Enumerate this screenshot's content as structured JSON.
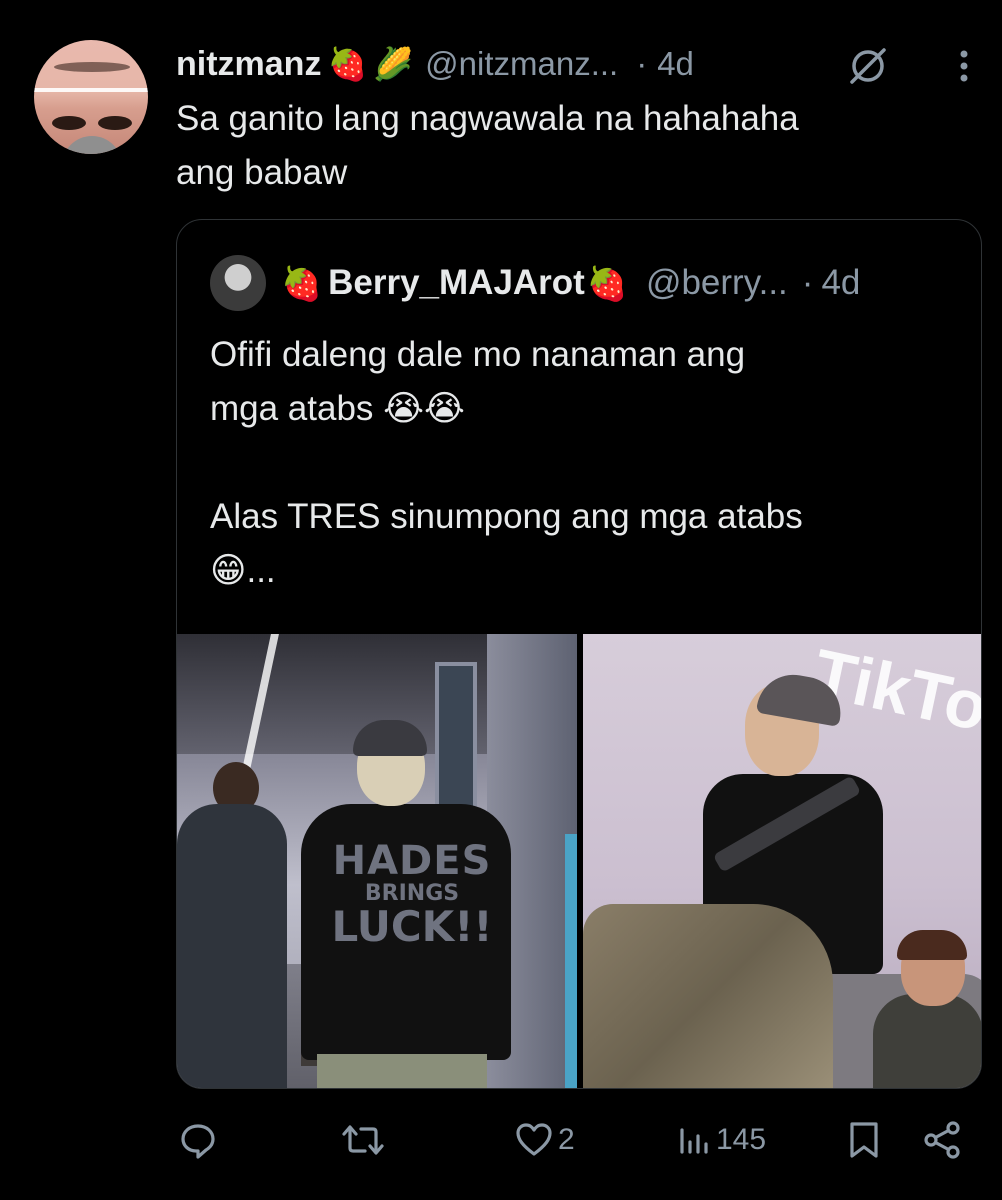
{
  "tweet": {
    "author_name": "nitzmanz",
    "author_emojis": [
      "🍓",
      "🌽"
    ],
    "handle": "@nitzmanz...",
    "separator": "·",
    "time": "4d",
    "text": "Sa ganito lang nagwawala na hahahaha\nang babaw"
  },
  "quote": {
    "author_name": "Berry_MAJArot",
    "emoji_before": "🍓",
    "emoji_after": "🍓",
    "handle": "@berry...",
    "separator": "·",
    "time": "4d",
    "text": "Ofifi daleng dale mo nanaman ang\nmga atabs 😭😭\n\nAlas TRES sinumpong ang mga atabs\n😁...",
    "photo_1_print": {
      "line1": "HADES",
      "line2": "BRINGS",
      "line3": "LUCK!!"
    },
    "photo_2_sign": "TikTo"
  },
  "actions": {
    "reply_count": "",
    "retweet_count": "",
    "like_count": "2",
    "view_count": "145"
  },
  "colors": {
    "background": "#000000",
    "text_primary": "#e7e9ea",
    "text_secondary": "#8b98a5",
    "border": "#2f3336"
  },
  "icons": [
    "grok-icon",
    "more-icon",
    "reply-icon",
    "retweet-icon",
    "like-icon",
    "views-icon",
    "bookmark-icon",
    "share-icon"
  ]
}
